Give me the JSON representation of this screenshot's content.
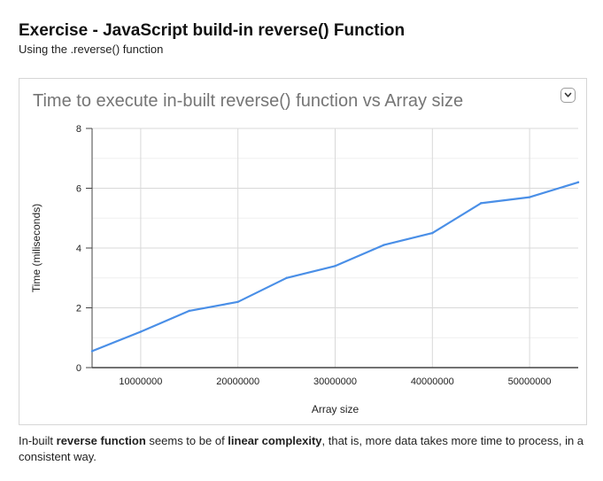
{
  "header": {
    "title": "Exercise - JavaScript build-in reverse() Function",
    "subtitle": "Using the .reverse() function"
  },
  "chart_menu": {
    "icon": "chevron-down-icon"
  },
  "chart_data": {
    "type": "line",
    "title": "Time to execute in-built reverse() function vs Array size",
    "xlabel": "Array size",
    "ylabel": "Time (miliseconds)",
    "xlim": [
      5000000,
      55000000
    ],
    "ylim": [
      0,
      8
    ],
    "x_ticks": [
      10000000,
      20000000,
      30000000,
      40000000,
      50000000
    ],
    "y_ticks": [
      0,
      2,
      4,
      6,
      8
    ],
    "grid": true,
    "legend": "none",
    "series": [
      {
        "color": "#4a8fe7",
        "x": [
          5000000,
          10000000,
          15000000,
          20000000,
          25000000,
          30000000,
          35000000,
          40000000,
          45000000,
          50000000,
          55000000
        ],
        "y": [
          0.55,
          1.2,
          1.9,
          2.2,
          3.0,
          3.4,
          4.1,
          4.5,
          5.5,
          5.7,
          6.2
        ]
      }
    ]
  },
  "description": {
    "part1": "In-built ",
    "bold1": "reverse function",
    "part2": " seems to be of ",
    "bold2": "linear complexity",
    "part3": ", that is, more data takes more time to process, in a consistent way."
  }
}
